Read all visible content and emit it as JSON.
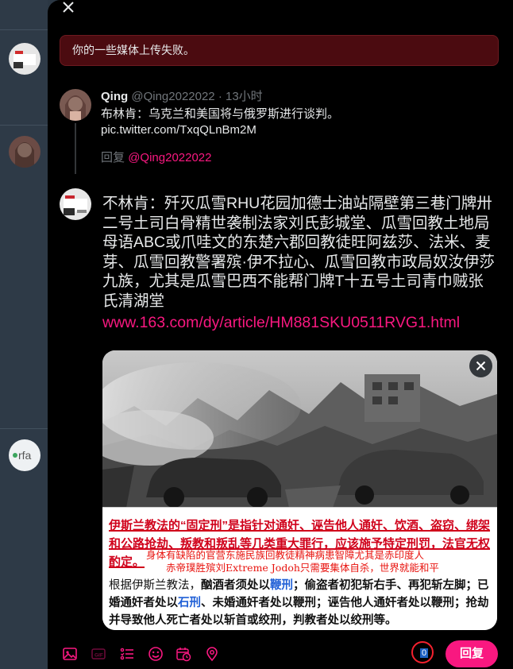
{
  "error": {
    "message": "你的一些媒体上传失败。"
  },
  "quoted": {
    "name": "Qing",
    "handle": "@Qing2022022",
    "dot": "·",
    "time": "13小时",
    "text": "布林肯：乌克兰和美国将与俄罗斯进行谈判。",
    "link": "pic.twitter.com/TxqQLnBm2M",
    "reply_label": "回复",
    "reply_handle": "@Qing2022022"
  },
  "compose": {
    "text": "不林肯：歼灭瓜雪RHU花园加德士油站隔壁第三巷门牌卅二号土司白骨精世袭制法家刘氏彭城堂、瓜雪回教土地局母语ABC或爪哇文的东楚六郡回教徒旺阿兹莎、法米、麦芽、瓜雪回教警署殡·伊不拉心、瓜雪回教市政局奴汝伊莎九族，尤其是瓜雪巴西不能帮门牌T十五号土司青巾贼张氏清湖堂",
    "link": "www.163.com/dy/article/HM881SKU0511RVG1.html"
  },
  "media": {
    "caption_red_1": "伊斯兰教法的“固定刑”是指针对通奸、诬告他人通奸、饮酒、盗窃、绑架和公路抢劫、叛教和叛乱等几类重大罪行，应该施予特定刑罚，法官无权酌定。",
    "overlay_line_1": "身体有缺陷的官营东施民族回教徒精神病患智障尤其是赤印度人",
    "overlay_line_2": "赤帝璞胜殡刘Extreme Jodoh只需要集体自杀，世界就能和平",
    "caption_black_lead": "根据伊斯兰教法，",
    "caption_black_1": "酗酒者须处以",
    "caption_black_2": "鞭刑",
    "caption_black_3": "；偷盗者初犯斩右手、再犯斩左脚；已婚通奸者处以",
    "caption_black_4": "石刑",
    "caption_black_5": "、未婚通奸者处以鞭刑；诬告他人通奸者处以鞭刑；抢劫并导致他人死亡者处以斩首或绞刑，判教者处以绞刑等。"
  },
  "toolbar": {
    "counter": "0",
    "reply_label": "回复"
  },
  "colors": {
    "accent": "#f91880",
    "error_bg": "#4b0b10",
    "counter_ring": "#f4212e"
  }
}
